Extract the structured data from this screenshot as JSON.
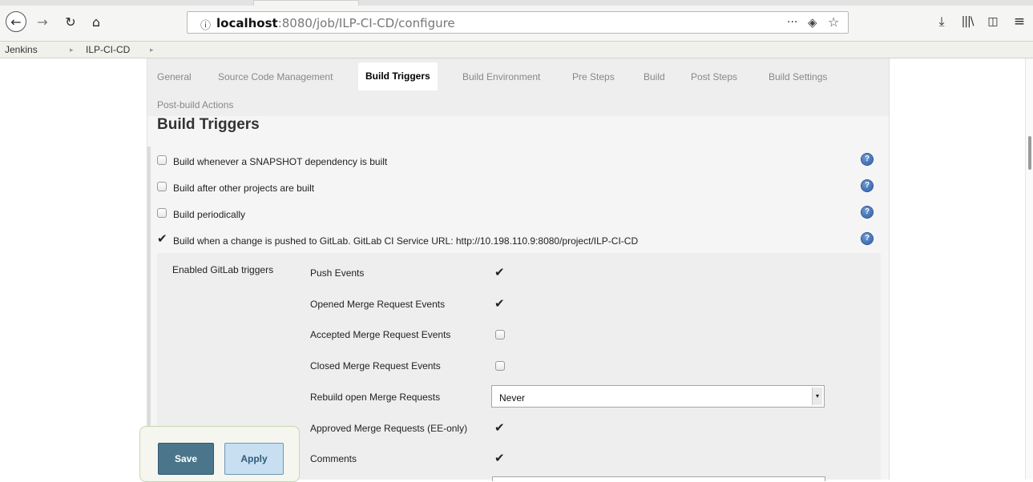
{
  "browser": {
    "url_host": "localhost",
    "url_rest": ":8080/job/ILP-CI-CD/configure",
    "icons": {
      "back": "←",
      "forward": "→",
      "reload": "↻",
      "home": "⌂",
      "info": "ⓘ",
      "more": "···",
      "pocket": "◈",
      "star": "☆",
      "download": "⤓",
      "library": "|||\\",
      "sidebar": "◫",
      "menu": "≡"
    }
  },
  "breadcrumb": {
    "items": [
      "Jenkins",
      "ILP-CI-CD"
    ],
    "separator": "▸"
  },
  "tabs": [
    "General",
    "Source Code Management",
    "Build Triggers",
    "Build Environment",
    "Pre Steps",
    "Build",
    "Post Steps",
    "Build Settings",
    "Post-build Actions"
  ],
  "active_tab": "Build Triggers",
  "section_title": "Build Triggers",
  "triggers": [
    {
      "label": "Build whenever a SNAPSHOT dependency is built",
      "checked": false
    },
    {
      "label": "Build after other projects are built",
      "checked": false
    },
    {
      "label": "Build periodically",
      "checked": false
    },
    {
      "label": "Build when a change is pushed to GitLab. GitLab CI Service URL: http://10.198.110.9:8080/project/ILP-CI-CD",
      "checked": true
    }
  ],
  "help_icon": "?",
  "gitlab": {
    "group_label": "Enabled GitLab triggers",
    "options": [
      {
        "label": "Push Events",
        "checked": true
      },
      {
        "label": "Opened Merge Request Events",
        "checked": true
      },
      {
        "label": "Accepted Merge Request Events",
        "checked": false
      },
      {
        "label": "Closed Merge Request Events",
        "checked": false
      },
      {
        "label": "Rebuild open Merge Requests",
        "select_value": "Never"
      },
      {
        "label": "Approved Merge Requests (EE-only)",
        "checked": true
      },
      {
        "label": "Comments",
        "checked": true
      }
    ]
  },
  "checkmark": "✔",
  "select_arrow": "▾",
  "buttons": {
    "save": "Save",
    "apply": "Apply"
  }
}
